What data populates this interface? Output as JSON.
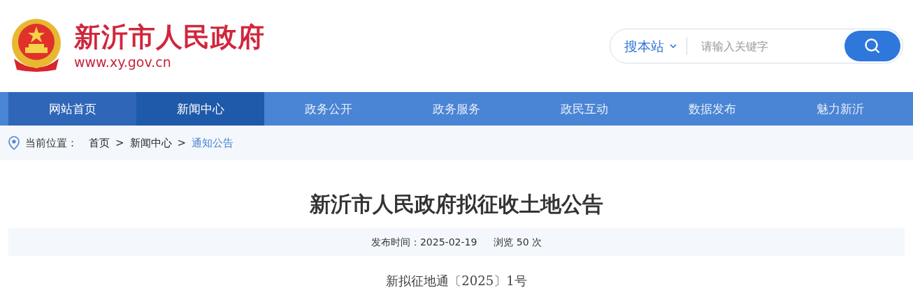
{
  "header": {
    "site_name": "新沂市人民政府",
    "site_url": "www.xy.gov.cn"
  },
  "search": {
    "scope": "搜本站",
    "placeholder": "请输入关键字"
  },
  "nav": [
    {
      "label": "网站首页",
      "selected": false,
      "hovered": true
    },
    {
      "label": "新闻中心",
      "selected": true,
      "hovered": false
    },
    {
      "label": "政务公开",
      "selected": false,
      "hovered": false
    },
    {
      "label": "政务服务",
      "selected": false,
      "hovered": false
    },
    {
      "label": "政民互动",
      "selected": false,
      "hovered": false
    },
    {
      "label": "数据发布",
      "selected": false,
      "hovered": false
    },
    {
      "label": "魅力新沂",
      "selected": false,
      "hovered": false
    }
  ],
  "breadcrumb": {
    "label": "当前位置：",
    "separator": ">",
    "items": [
      {
        "text": "首页",
        "current": false
      },
      {
        "text": "新闻中心",
        "current": false
      },
      {
        "text": "通知公告",
        "current": true
      }
    ]
  },
  "article": {
    "title": "新沂市人民政府拟征收土地公告",
    "publish_time": "发布时间：2025-02-19",
    "views": "浏览 50 次",
    "doc_number": "新拟征地通〔2025〕1号"
  }
}
